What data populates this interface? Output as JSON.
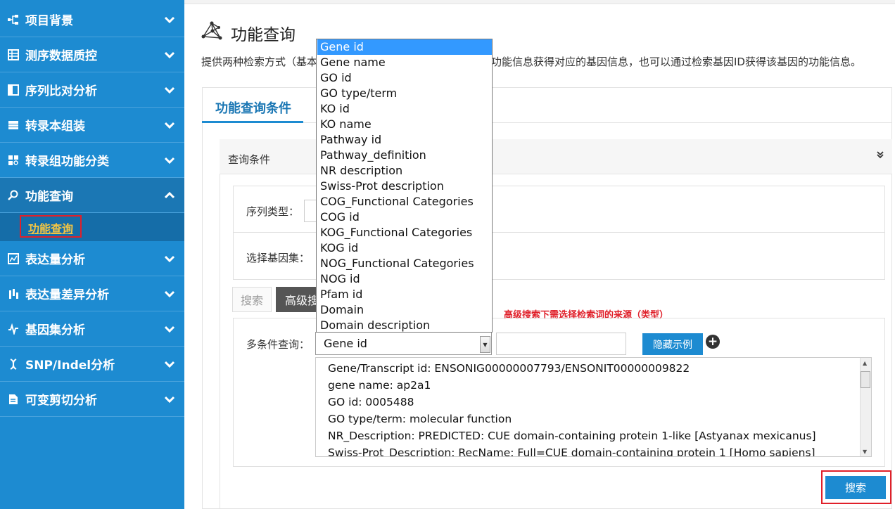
{
  "sidebar": {
    "items": [
      {
        "label": "项目背景",
        "icon": "hierarchy-icon"
      },
      {
        "label": "测序数据质控",
        "icon": "table-icon"
      },
      {
        "label": "序列比对分析",
        "icon": "panel-icon"
      },
      {
        "label": "转录本组装",
        "icon": "server-icon"
      },
      {
        "label": "转录组功能分类",
        "icon": "grid-search-icon"
      },
      {
        "label": "功能查询",
        "icon": "search-icon"
      },
      {
        "label": "表达量分析",
        "icon": "chart-icon"
      },
      {
        "label": "表达量差异分析",
        "icon": "bars-icon"
      },
      {
        "label": "基因集分析",
        "icon": "pulse-icon"
      },
      {
        "label": "SNP/Indel分析",
        "icon": "dna-icon"
      },
      {
        "label": "可变剪切分析",
        "icon": "document-icon"
      }
    ],
    "active_sub": "功能查询"
  },
  "page": {
    "title": "功能查询",
    "desc_left": "提供两种检索方式（基本",
    "desc_right": "功能信息获得对应的基因信息，也可以通过检索基因ID获得该基因的功能信息。",
    "tab": "功能查询条件"
  },
  "query": {
    "header": "查询条件",
    "seq_type_label": "序列类型：",
    "gene_set_label": "选择基因集：",
    "search_tab": "搜索",
    "advanced_tab": "高级搜索",
    "note": "高级搜索下需选择检索词的来源（类型）",
    "multi_label": "多条件查询：",
    "selected": "Gene id",
    "hide_button": "隐藏示例",
    "search_button": "搜索"
  },
  "dropdown": {
    "options": [
      "Gene id",
      "Gene name",
      "GO id",
      "GO type/term",
      "KO id",
      "KO name",
      "Pathway id",
      "Pathway_definition",
      "NR description",
      "Swiss-Prot description",
      "COG_Functional Categories",
      "COG id",
      "KOG_Functional Categories",
      "KOG id",
      "NOG_Functional Categories",
      "NOG id",
      "Pfam id",
      "Domain",
      "Domain description"
    ]
  },
  "examples": [
    "Gene/Transcript id: ENSONIG00000007793/ENSONIT00000009822",
    "gene name: ap2a1",
    "GO id: 0005488",
    "GO type/term: molecular function",
    "NR_Description: PREDICTED: CUE domain-containing protein 1-like [Astyanax mexicanus]",
    "Swiss-Prot_Description: RecName: Full=CUE domain-containing protein 1 [Homo sapiens]"
  ],
  "colors": {
    "sidebar": "#1d8bd1",
    "accent": "#1d8bd1",
    "highlight": "#e0202a",
    "selected_option": "#3399ff"
  }
}
